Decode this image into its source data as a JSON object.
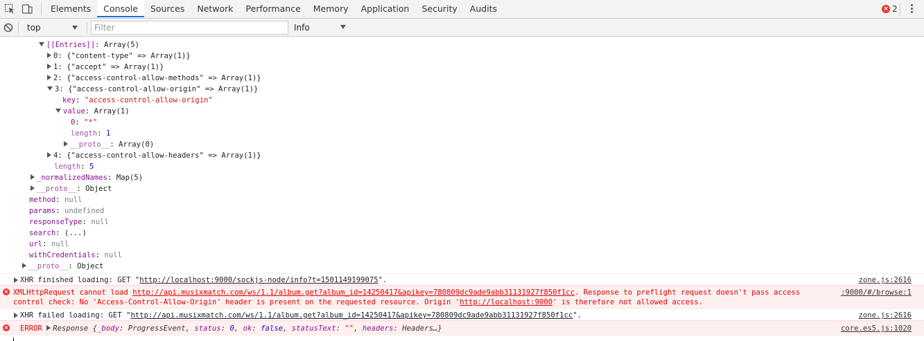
{
  "tabbar": {
    "tabs": [
      "Elements",
      "Console",
      "Sources",
      "Network",
      "Performance",
      "Memory",
      "Application",
      "Security",
      "Audits"
    ],
    "active_tab": "Console",
    "error_count": "2"
  },
  "filterbar": {
    "context": "top",
    "filter_placeholder": "Filter",
    "level": "Info"
  },
  "tree": {
    "entries_label": "[[Entries]]",
    "entries_value": "Array(5)",
    "e0": "0: {\"content-type\" => Array(1)}",
    "e1": "1: {\"accept\" => Array(1)}",
    "e2": "2: {\"access-control-allow-methods\" => Array(1)}",
    "e3": "3: {\"access-control-allow-origin\" => Array(1)}",
    "key_label": "key",
    "key_value": "\"access-control-allow-origin\"",
    "value_label": "value",
    "value_value": "Array(1)",
    "v0_label": "0",
    "v0_value": "\"*\"",
    "vlen_label": "length",
    "vlen_value": "1",
    "vproto_label": "__proto__",
    "vproto_value": "Array(0)",
    "e4": "4: {\"access-control-allow-headers\" => Array(1)}",
    "elen_label": "length",
    "elen_value": "5",
    "norm_label": "_normalizedNames",
    "norm_value": "Map(5)",
    "proto1_label": "__proto__",
    "proto1_value": "Object",
    "method_label": "method",
    "method_value": "null",
    "params_label": "params",
    "params_value": "undefined",
    "resp_label": "responseType",
    "resp_value": "null",
    "search_label": "search",
    "search_value": "(...)",
    "url_label": "url",
    "url_value": "null",
    "wc_label": "withCredentials",
    "wc_value": "null",
    "proto2_label": "__proto__",
    "proto2_value": "Object"
  },
  "messages": {
    "m1_prefix": "XHR finished loading: GET \"",
    "m1_link": "http://localhost:9000/sockjs-node/info?t=1501149199075",
    "m1_suffix": "\".",
    "m1_src": "zone.js:2616",
    "m2_prefix": "XMLHttpRequest cannot load ",
    "m2_link": "http://api.musixmatch.com/ws/1.1/album.get?album_id=14250417&apikey=780809dc9ade9abb31131927f850f1cc",
    "m2_suffix": ". Response to preflight request doesn't pass access",
    "m2_line2_prefix": "control check: No 'Access-Control-Allow-Origin' header is present on the requested resource. Origin '",
    "m2_line2_link": "http://localhost:9000",
    "m2_line2_suffix": "' is therefore not allowed access.",
    "m2_src": ":9000/#/browse:1",
    "m3_prefix": "XHR failed loading: GET \"",
    "m3_link": "http://api.musixmatch.com/ws/1.1/album.get?album_id=14250417&apikey=780809dc9ade9abb31131927f850f1cc",
    "m3_suffix": "\".",
    "m3_src": "zone.js:2616",
    "m4_label": "ERROR",
    "m4_obj": "Response {",
    "m4_body_k": "_body",
    "m4_body_v": "ProgressEvent",
    "m4_status_k": "status",
    "m4_status_v": "0",
    "m4_ok_k": "ok",
    "m4_ok_v": "false",
    "m4_st_k": "statusText",
    "m4_st_v": "\"\"",
    "m4_h_k": "headers",
    "m4_h_v": "Headers…}",
    "m4_src": "core.es5.js:1020"
  },
  "colors": {
    "accent": "#1a73e8",
    "error": "#e53935",
    "property": "#881391",
    "string": "#c41a16",
    "number": "#1c00cf"
  }
}
